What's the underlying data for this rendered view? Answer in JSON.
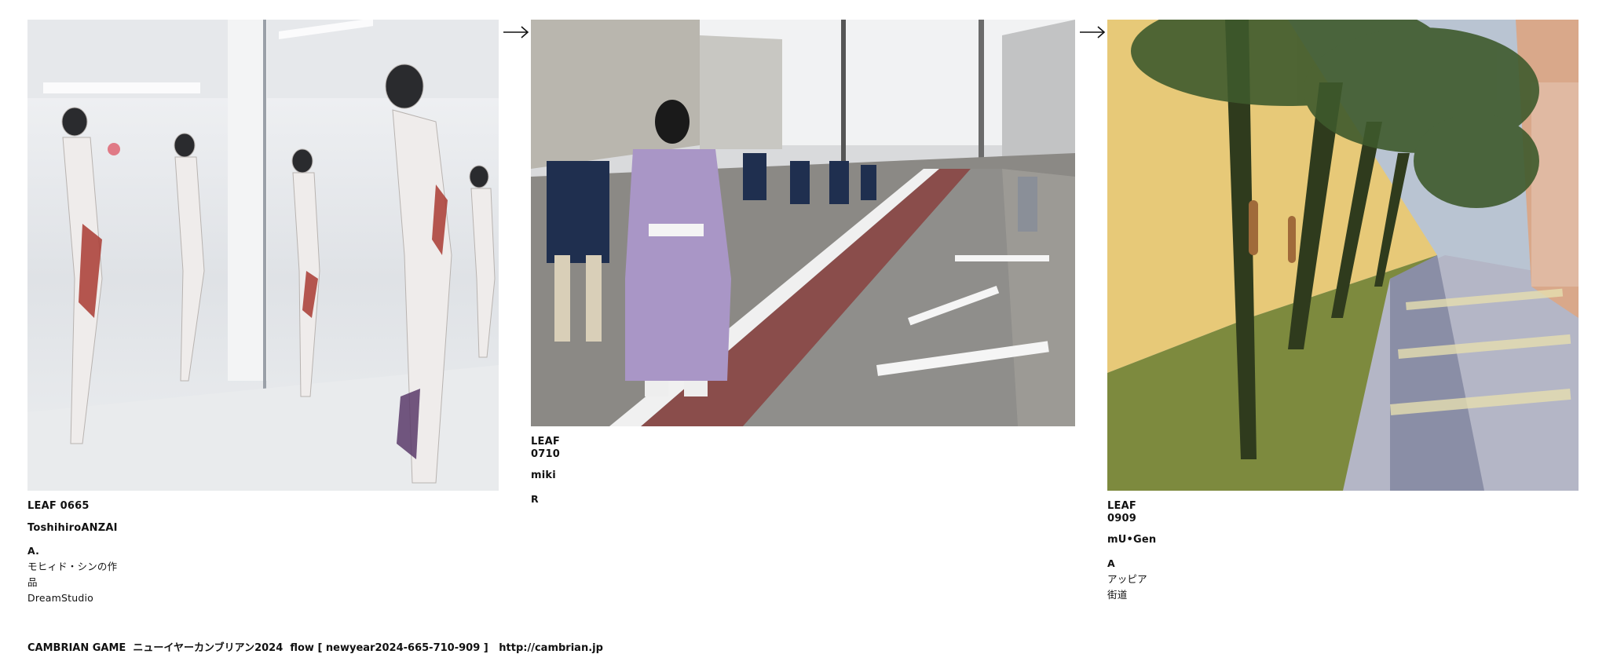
{
  "leaves": [
    {
      "id": "LEAF 0665",
      "author": "ToshihiroANZAI",
      "notes": [
        "A.",
        "モヒィド・シンの作品",
        "DreamStudio"
      ]
    },
    {
      "id": "LEAF 0710",
      "author": "miki",
      "notes": [
        "R"
      ]
    },
    {
      "id": "LEAF 0909",
      "author": "mU•Gen",
      "notes": [
        "A",
        "アッピア街道"
      ]
    }
  ],
  "footer": {
    "title": "CAMBRIAN GAME",
    "subtitle": "ニューイヤーカンブリアン2024",
    "flow_label": "flow",
    "flow_code": "[ newyear2024-665-710-909 ]",
    "url": "http://cambrian.jp"
  },
  "icons": [
    "arrow-right-icon"
  ]
}
